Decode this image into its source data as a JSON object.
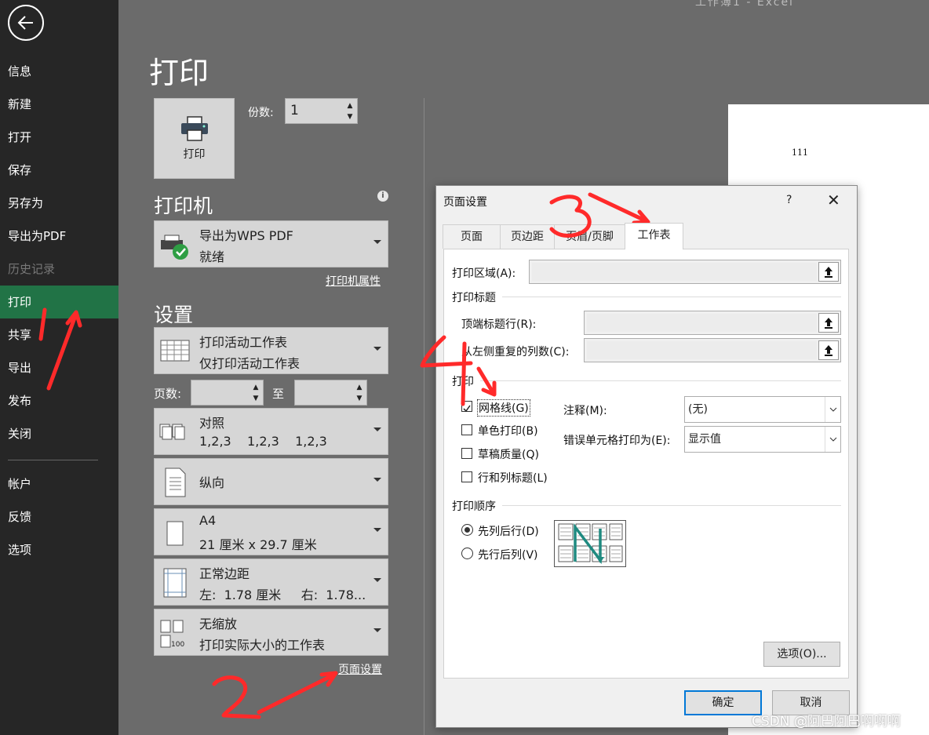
{
  "window": {
    "title": "工作簿1 - Excel"
  },
  "sidebar": {
    "items": [
      {
        "label": "信息"
      },
      {
        "label": "新建"
      },
      {
        "label": "打开"
      },
      {
        "label": "保存"
      },
      {
        "label": "另存为"
      },
      {
        "label": "导出为PDF"
      },
      {
        "label": "历史记录"
      },
      {
        "label": "打印"
      },
      {
        "label": "共享"
      },
      {
        "label": "导出"
      },
      {
        "label": "发布"
      },
      {
        "label": "关闭"
      },
      {
        "label": "帐户"
      },
      {
        "label": "反馈"
      },
      {
        "label": "选项"
      }
    ],
    "active_label": "打印",
    "disabled_label": "历史记录"
  },
  "main": {
    "title": "打印",
    "print_button_label": "打印",
    "copies_label": "份数:",
    "copies_value": "1",
    "printer_heading": "打印机",
    "printer": {
      "name": "导出为WPS PDF",
      "status": "就绪"
    },
    "printer_properties_link": "打印机属性",
    "settings_heading": "设置",
    "settings": {
      "scope": {
        "line1": "打印活动工作表",
        "line2": "仅打印活动工作表"
      },
      "pages_label": "页数:",
      "to_label": "至",
      "collate": {
        "line1": "对照",
        "line2": "1,2,3    1,2,3    1,2,3"
      },
      "orientation": {
        "line1": "纵向"
      },
      "paper": {
        "line1": "A4",
        "line2": "21 厘米 x 29.7 厘米"
      },
      "margins": {
        "line1": "正常边距",
        "line2": "左:  1.78 厘米     右:  1.78..."
      },
      "scaling": {
        "line1": "无缩放",
        "line2": "打印实际大小的工作表"
      }
    },
    "page_setup_link": "页面设置",
    "preview_text": "111",
    "scaling_icon_text": "100"
  },
  "dialog": {
    "title": "页面设置",
    "help": "?",
    "close": "✕",
    "tabs": [
      "页面",
      "页边距",
      "页眉/页脚",
      "工作表"
    ],
    "active_tab": "工作表",
    "print_area_label": "打印区域(A):",
    "print_titles_group": "打印标题",
    "rows_to_repeat_label": "顶端标题行(R):",
    "cols_to_repeat_label": "从左侧重复的列数(C):",
    "print_group": "打印",
    "checkboxes": [
      {
        "label": "网格线(G)",
        "checked": true
      },
      {
        "label": "单色打印(B)",
        "checked": false
      },
      {
        "label": "草稿质量(Q)",
        "checked": false
      },
      {
        "label": "行和列标题(L)",
        "checked": false
      }
    ],
    "comments_label": "注释(M):",
    "comments_value": "(无)",
    "errors_label": "错误单元格打印为(E):",
    "errors_value": "显示值",
    "page_order_group": "打印顺序",
    "radios": [
      {
        "label": "先列后行(D)",
        "selected": true
      },
      {
        "label": "先行后列(V)",
        "selected": false
      }
    ],
    "options_button": "选项(O)...",
    "ok_button": "确定",
    "cancel_button": "取消"
  },
  "annotations": {
    "color": "#ff2a2a",
    "numbers": [
      "1",
      "2",
      "3",
      "4"
    ]
  },
  "watermark": "CSDN @阿巴阿巴啊啊啊"
}
